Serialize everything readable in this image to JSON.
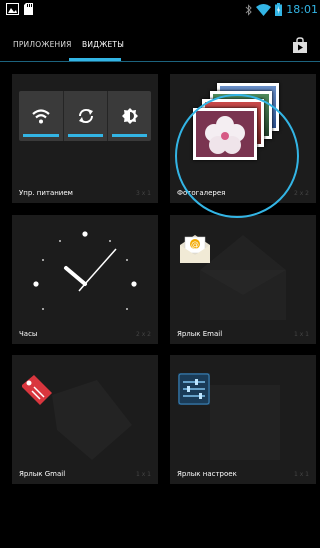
{
  "status_bar": {
    "time": "18:01",
    "icons": [
      "image-icon",
      "sd-card-icon",
      "bluetooth-icon",
      "wifi-icon",
      "battery-icon"
    ]
  },
  "tabs": [
    {
      "label": "ПРИЛОЖЕНИЯ",
      "selected": false
    },
    {
      "label": "ВИДЖЕТЫ",
      "selected": true
    }
  ],
  "store_icon": "play-store-icon",
  "widgets": [
    {
      "label": "Упр. питанием",
      "size": "3 x 1",
      "icon": "power-control-preview"
    },
    {
      "label": "Фотогалерея",
      "size": "2 x 2",
      "icon": "photo-gallery-preview"
    },
    {
      "label": "Часы",
      "size": "2 x 2",
      "icon": "analog-clock-preview"
    },
    {
      "label": "Ярлык Email",
      "size": "1 x 1",
      "icon": "email-icon"
    },
    {
      "label": "Ярлык Gmail",
      "size": "1 x 1",
      "icon": "gmail-tag-icon"
    },
    {
      "label": "Ярлык настроек",
      "size": "1 x 1",
      "icon": "settings-icon"
    }
  ],
  "colors": {
    "accent": "#33b5e5",
    "card": "#1c1c1c",
    "background": "#000000"
  }
}
